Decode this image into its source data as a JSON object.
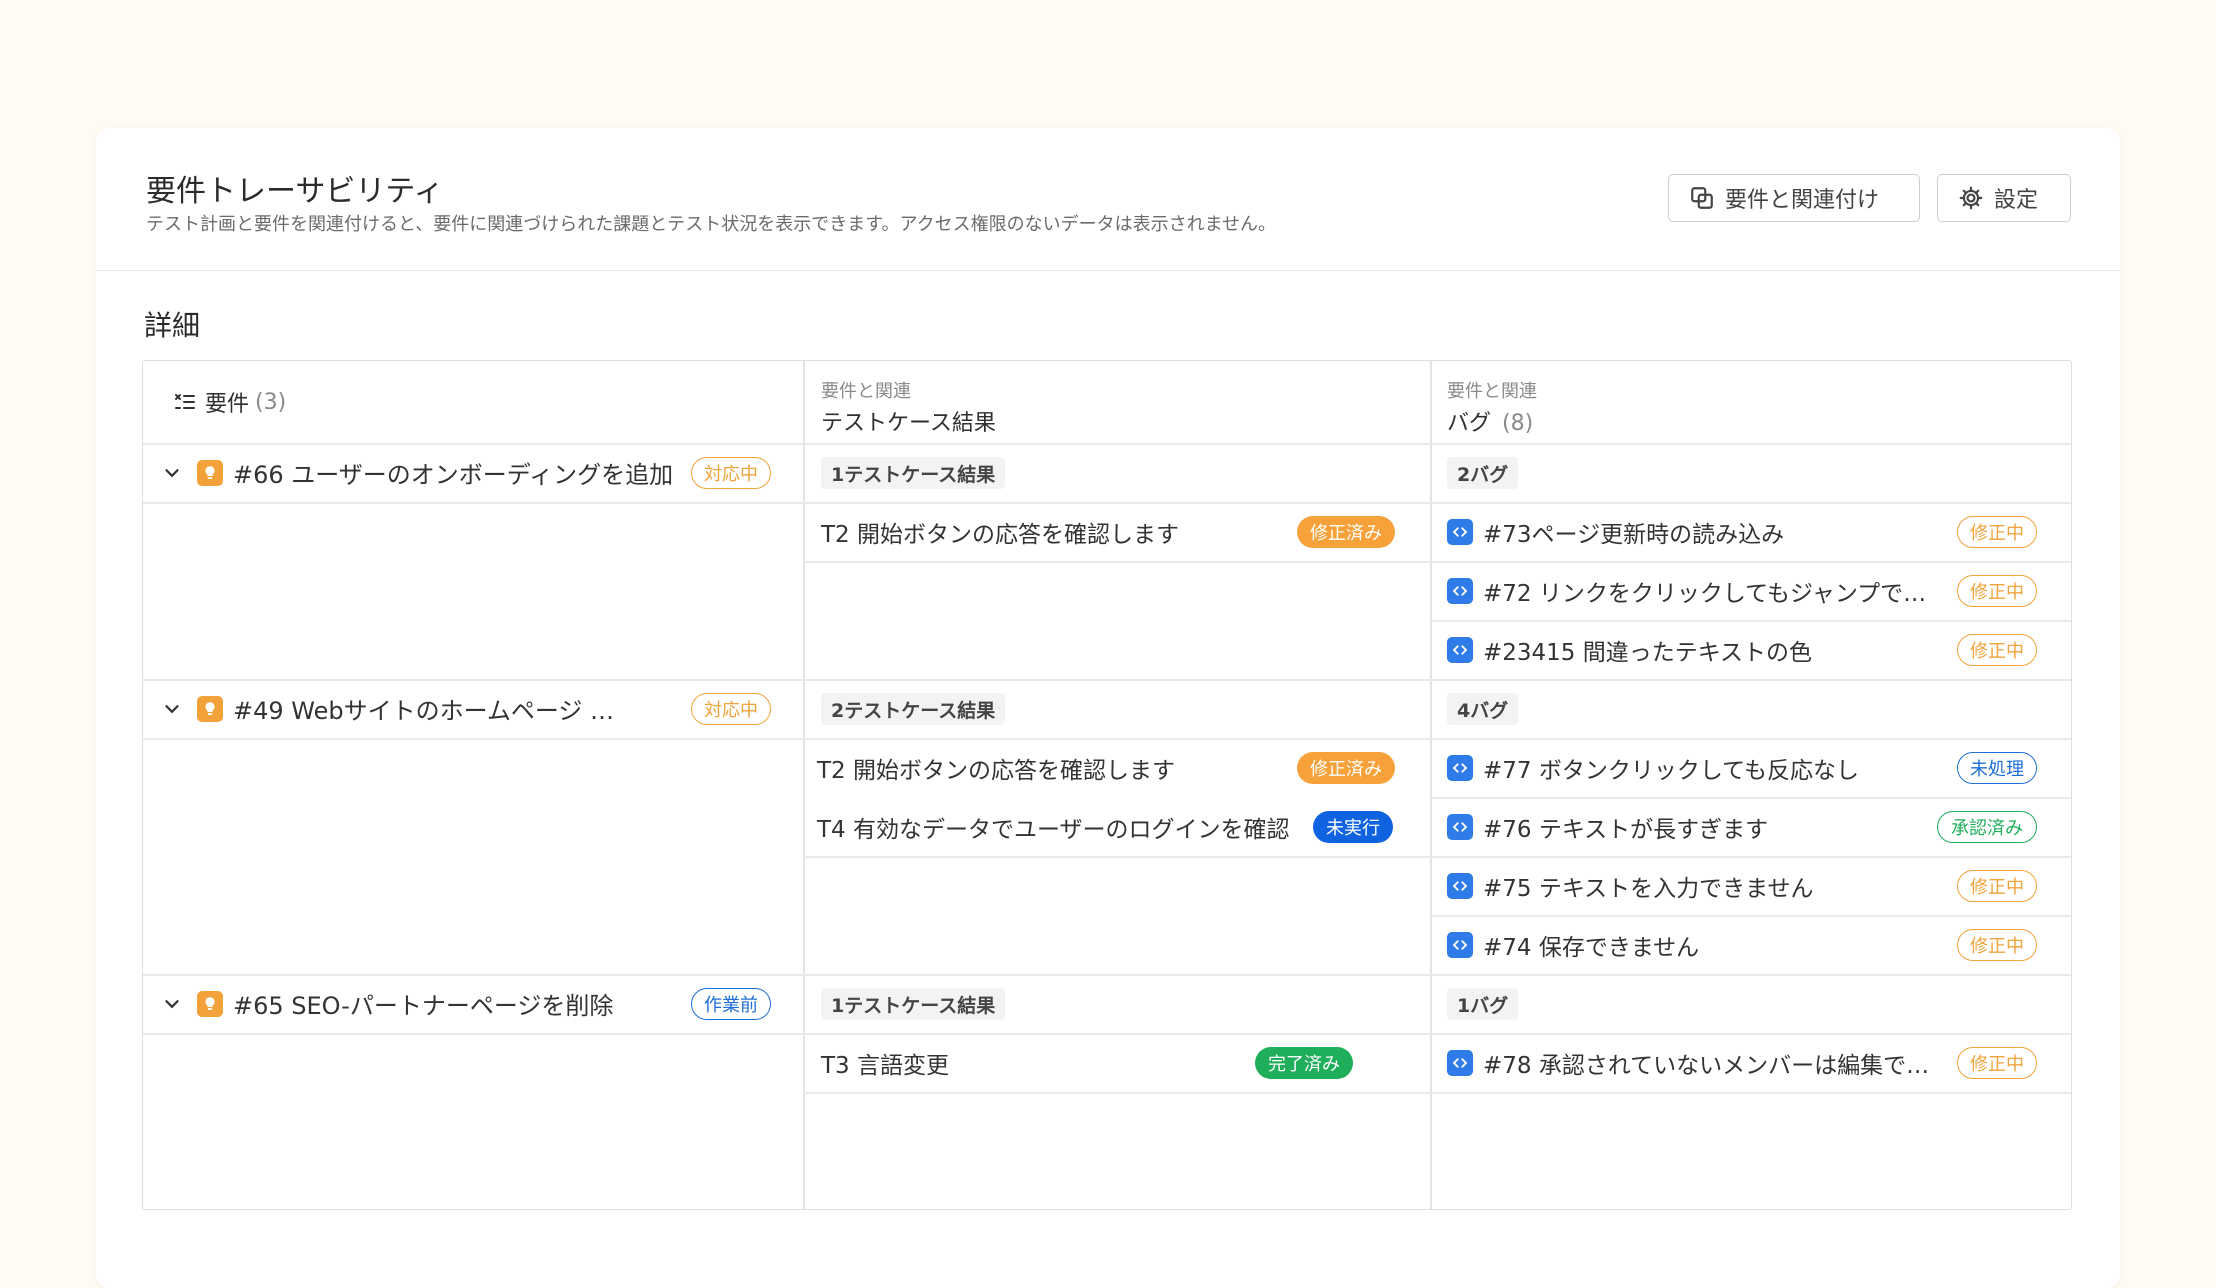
{
  "header": {
    "title": "要件トレーサビリティ",
    "subtitle": "テスト計画と要件を関連付けると、要件に関連づけられた課題とテスト状況を表示できます。アクセス権限のないデータは表示されません。",
    "link_button": "要件と関連付け",
    "settings_button": "設定"
  },
  "section_title": "詳細",
  "columns": {
    "requirements": {
      "label": "要件",
      "count": "(3)"
    },
    "testcases": {
      "small": "要件と関連",
      "main": "テストケース結果"
    },
    "bugs": {
      "small": "要件と関連",
      "main": "バグ",
      "count": "(8)"
    }
  },
  "groups": [
    {
      "requirement": "#66 ユーザーのオンボーディングを追加",
      "status": "対応中",
      "testcase_count": "1テストケース結果",
      "bug_count": "2バグ",
      "testcases": [
        {
          "name": "T2 開始ボタンの応答を確認します",
          "status": "修正済み"
        }
      ],
      "bugs": [
        {
          "name": "#73ページ更新時の読み込み",
          "status": "修正中"
        },
        {
          "name": "#72 リンクをクリックしてもジャンプでき…",
          "status": "修正中"
        },
        {
          "name": "#23415 間違ったテキストの色",
          "status": "修正中"
        }
      ]
    },
    {
      "requirement": "#49 Webサイトのホームページ …",
      "status": "対応中",
      "testcase_count": "2テストケース結果",
      "bug_count": "4バグ",
      "testcases": [
        {
          "name": "T2 開始ボタンの応答を確認します",
          "status": "修正済み"
        },
        {
          "name": "T4 有効なデータでユーザーのログインを確認",
          "status": "未実行"
        }
      ],
      "bugs": [
        {
          "name": "#77 ボタンクリックしても反応なし",
          "status": "未処理"
        },
        {
          "name": "#76 テキストが長すぎます",
          "status": "承認済み"
        },
        {
          "name": "#75 テキストを入力できません",
          "status": "修正中"
        },
        {
          "name": "#74 保存できません",
          "status": "修正中"
        }
      ]
    },
    {
      "requirement": "#65 SEO-パートナーページを削除",
      "status": "作業前",
      "testcase_count": "1テストケース結果",
      "bug_count": "1バグ",
      "testcases": [
        {
          "name": "T3 言語変更",
          "status": "完了済み"
        }
      ],
      "bugs": [
        {
          "name": "#78 承認されていないメンバーは編集でき…",
          "status": "修正中"
        }
      ]
    }
  ],
  "colors": {
    "page_bg": "#fffbf3",
    "orange": "#f1a33c",
    "blue": "#1e6fd9",
    "green": "#1fae5a",
    "bug_icon": "#2f7ce8",
    "idea_icon": "#f3a23a"
  },
  "icons": {
    "link": "link-icon",
    "settings": "gear-icon",
    "requirements": "list-icon",
    "expand": "chevron-down-icon",
    "requirement_item": "lightbulb-icon",
    "bug_item": "code-icon"
  }
}
